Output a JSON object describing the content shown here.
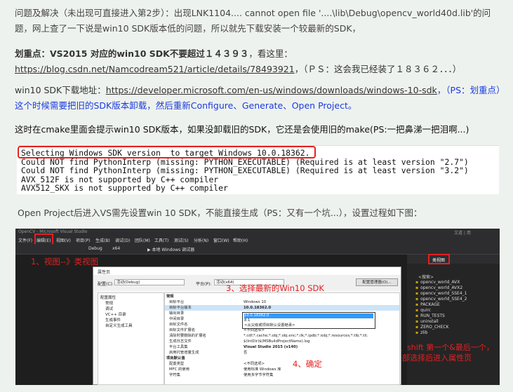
{
  "paragraphs": {
    "p1": "问题及解决（未出现可直接进入第2步）：出现LNK1104.... cannot open file '....\\lib\\Debug\\opencv_world40d.lib'的问题，网上查了一下说是win10 SDK版本低的问题，所以就先下载安装一个较最新的SDK，",
    "p2_bold": "划重点：VS2015 对应的win10 SDK不要超过１４３９３",
    "p2_rest": "，看这里：",
    "p2_link": "https://blog.csdn.net/Namcodream521/article/details/78493921",
    "p2_tail": "，（ＰＳ：这会我已经装了１８３６２．．．）",
    "p3_label": "win10 SDK下载地址：",
    "p3_link": "https://developer.microsoft.com/en-us/windows/downloads/windows-10-sdk",
    "p3_note": "，（PS：划重点）这个时候需要把旧的SDK版本卸载，然后重新Configure、Generate、Open Project。",
    "p4": "这时在cmake里面会提示win10 SDK版本，如果没卸载旧的SDK，它还是会使用旧的make(PS:一把鼻涕一把泪啊...)",
    "p5": "Open Project后进入VS需先设置win 10 SDK，不能直接生成（PS：又有一个坑...），设置过程如下图："
  },
  "console": {
    "lines": [
      "Selecting Windows SDK version  to target Windows 10.0.18362.",
      "Could NOT find PythonInterp (missing: PYTHON_EXECUTABLE) (Required is at least version \"2.7\")",
      "Could NOT find PythonInterp (missing: PYTHON_EXECUTABLE) (Required is at least version \"3.2\")",
      "AVX_512F is not supported by C++ compiler",
      "AVX512_SKX is not supported by C++ compiler"
    ]
  },
  "vs": {
    "title": "OpenCV - Microsoft Visual Studio",
    "user": "文道 | 用",
    "menu": [
      "文件(F)",
      "编辑(E)",
      "视图(V)",
      "项目(P)",
      "生成(B)",
      "调试(D)",
      "团队(M)",
      "工具(T)",
      "测试(S)",
      "分析(N)",
      "窗口(W)",
      "帮助(H)"
    ],
    "toolbar": {
      "config": "Debug",
      "platform": "x64",
      "debugger": "▶ 本地 Windows 调试器"
    },
    "panel_title": "类视图",
    "search": "<搜索>",
    "tree": [
      "opencv_world_AVX",
      "opencv_world_AVX2",
      "opencv_world_SSE4_1",
      "opencv_world_SSE4_2",
      "PACKAGE",
      "quirc",
      "RUN_TESTS",
      "uninstall",
      "ZERO_CHECK",
      "zlib"
    ],
    "annotations": {
      "a1": "1、视图--》类视图",
      "a2": "2、shift 第一个&最后一个，全部选择后进入属性页",
      "a3": "3、选择最新的Win10 SDK",
      "a4": "4、确定"
    },
    "dialog": {
      "title": "属性页",
      "config_label": "配置(C):",
      "config_value": "活动(Debug)",
      "platform_label": "平台(P):",
      "platform_value": "活动(x64)",
      "manager_button": "配置管理器(O)...",
      "tree": [
        "配置属性",
        "常规",
        "调试",
        "VC++ 目录",
        "生成事件",
        "自定义生成工具"
      ],
      "rows": [
        {
          "k": "常规",
          "v": ""
        },
        {
          "k": "目标平台",
          "v": "Windows 10"
        },
        {
          "k": "目标平台版本",
          "v": "10.0.18362.0"
        },
        {
          "k": "输出目录",
          "v": "10.0.18362.0"
        },
        {
          "k": "中间目录",
          "v": "8.1"
        },
        {
          "k": "目标文件名",
          "v": "<从父级或项目默认设置继承>"
        },
        {
          "k": "目标文件扩展名",
          "v": "<不同选项>"
        },
        {
          "k": "清除时要删除的扩展名",
          "v": "*.cdf;*.cache;*.obj;*.obj.enc;*.ilk;*.ipdb;*.iobj;*.resources;*.tlb;*.tli;"
        },
        {
          "k": "生成日志文件",
          "v": "$(IntDir)$(MSBuildProjectName).log"
        },
        {
          "k": "平台工具集",
          "v": "Visual Studio 2015 (v140)"
        },
        {
          "k": "启用托管增量生成",
          "v": "否"
        },
        {
          "k": "项目默认值",
          "v": ""
        },
        {
          "k": "配置类型",
          "v": "<不同选项>"
        },
        {
          "k": "MFC 的使用",
          "v": "使用标准 Windows 库"
        },
        {
          "k": "字符集",
          "v": "使用多字节字符集"
        }
      ]
    }
  }
}
